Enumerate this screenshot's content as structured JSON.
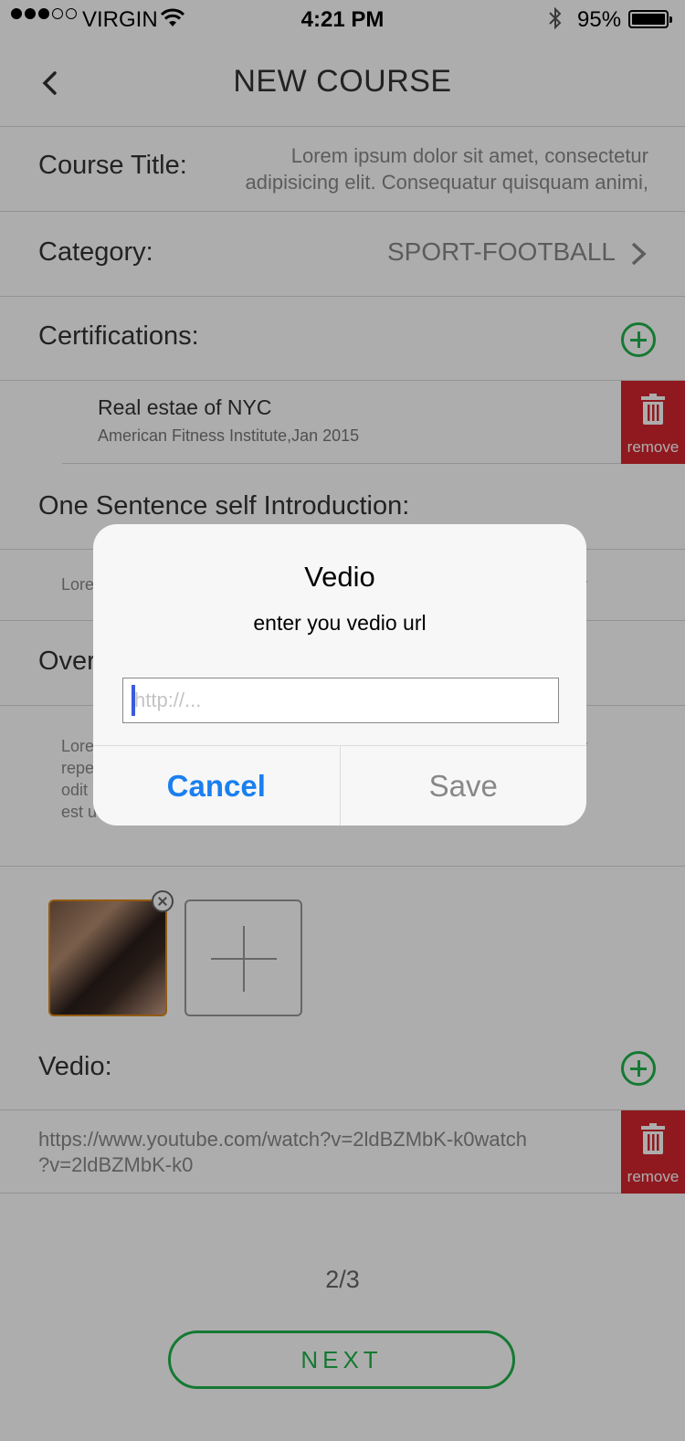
{
  "status_bar": {
    "carrier": "VIRGIN",
    "time": "4:21 PM",
    "battery": "95%"
  },
  "nav": {
    "title": "NEW COURSE"
  },
  "course_title": {
    "label": "Course Title:",
    "value_line1": "Lorem ipsum dolor sit amet, consectetur",
    "value_line2": "adipisicing elit. Consequatur quisquam animi,"
  },
  "category": {
    "label": "Category:",
    "value": "SPORT-FOOTBALL"
  },
  "certifications": {
    "label": "Certifications:",
    "items": [
      {
        "title": "Real estae of NYC",
        "subtitle": "American Fitness Institute,Jan 2015",
        "remove_label": "remove"
      }
    ]
  },
  "introduction": {
    "label": "One Sentence self Introduction:",
    "partial_text": "Lore",
    "partial_tail": "r"
  },
  "overview": {
    "label_partial": "Over",
    "lines": [
      "Lore",
      "repe",
      "odit",
      "est u"
    ],
    "tail": "r"
  },
  "vedio": {
    "label": "Vedio:",
    "url_line1": "https://www.youtube.com/watch?v=2ldBZMbK-k0watch",
    "url_line2": "?v=2ldBZMbK-k0",
    "remove_label": "remove"
  },
  "footer": {
    "page_indicator": "2/3",
    "next_label": "NEXT"
  },
  "dialog": {
    "title": "Vedio",
    "message": "enter you vedio url",
    "input_placeholder": "http://...",
    "cancel_label": "Cancel",
    "save_label": "Save"
  },
  "colors": {
    "accent_green": "#1fb34a",
    "remove_red": "#d3252f",
    "ios_blue": "#1a7ff0"
  }
}
